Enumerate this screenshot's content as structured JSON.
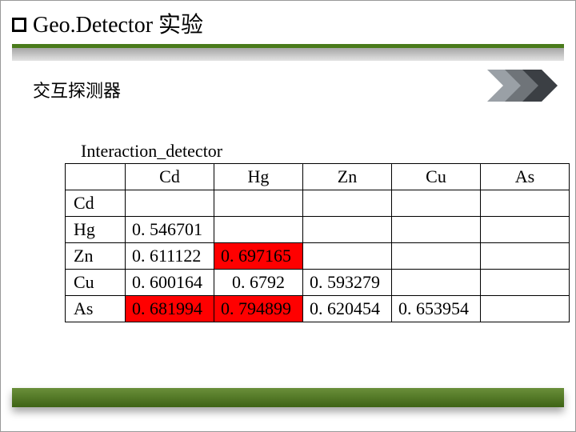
{
  "title": "Geo.Detector 实验",
  "subtitle": "交互探测器",
  "table_title": "Interaction_detector",
  "columns": [
    "Cd",
    "Hg",
    "Zn",
    "Cu",
    "As"
  ],
  "rows": [
    "Cd",
    "Hg",
    "Zn",
    "Cu",
    "As"
  ],
  "cells": {
    "Hg_Cd": "0. 546701",
    "Zn_Cd": "0. 611122",
    "Zn_Hg": "0. 697165",
    "Cu_Cd": "0. 600164",
    "Cu_Hg": "0. 6792",
    "Cu_Zn": "0. 593279",
    "As_Cd": "0. 681994",
    "As_Hg": "0. 794899",
    "As_Zn": "0. 620454",
    "As_Cu": "0. 653954"
  },
  "highlight_cells": [
    "Zn_Hg",
    "As_Cd",
    "As_Hg"
  ],
  "colors": {
    "accent_green": "#4a7b1b",
    "highlight": "#ff0000"
  },
  "chart_data": {
    "type": "table",
    "title": "Interaction_detector",
    "row_labels": [
      "Cd",
      "Hg",
      "Zn",
      "Cu",
      "As"
    ],
    "col_labels": [
      "Cd",
      "Hg",
      "Zn",
      "Cu",
      "As"
    ],
    "matrix": [
      [
        null,
        null,
        null,
        null,
        null
      ],
      [
        0.546701,
        null,
        null,
        null,
        null
      ],
      [
        0.611122,
        0.697165,
        null,
        null,
        null
      ],
      [
        0.600164,
        0.6792,
        0.593279,
        null,
        null
      ],
      [
        0.681994,
        0.794899,
        0.620454,
        0.653954,
        null
      ]
    ]
  }
}
